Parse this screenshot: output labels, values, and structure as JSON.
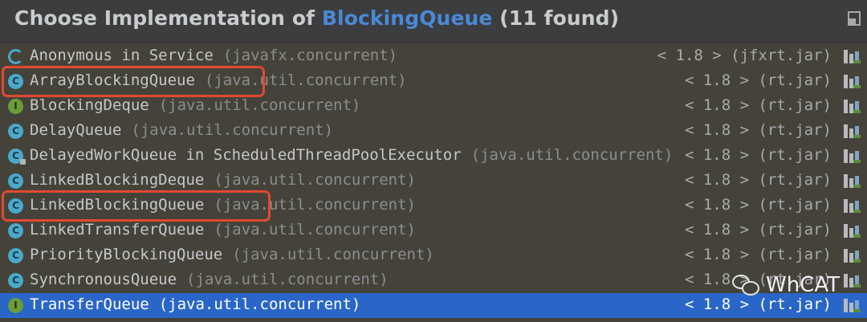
{
  "header": {
    "title_prefix": "Choose Implementation of ",
    "title_class": "BlockingQueue",
    "title_suffix": " (11 found)"
  },
  "items": [
    {
      "kind": "anonymous",
      "name": "Anonymous in Service",
      "package": "(javafx.concurrent)",
      "version": "< 1.8 > (jfxrt.jar)",
      "highlighted": false,
      "selected": false
    },
    {
      "kind": "class",
      "name": "ArrayBlockingQueue",
      "package": "(java.util.concurrent)",
      "version": "< 1.8 > (rt.jar)",
      "highlighted": true,
      "selected": false
    },
    {
      "kind": "interface",
      "name": "BlockingDeque",
      "package": "(java.util.concurrent)",
      "version": "< 1.8 > (rt.jar)",
      "highlighted": false,
      "selected": false
    },
    {
      "kind": "class",
      "name": "DelayQueue",
      "package": "(java.util.concurrent)",
      "version": "< 1.8 > (rt.jar)",
      "highlighted": false,
      "selected": false
    },
    {
      "kind": "class-private",
      "name": "DelayedWorkQueue in ScheduledThreadPoolExecutor",
      "package": "(java.util.concurrent)",
      "version": "< 1.8 > (rt.jar)",
      "highlighted": false,
      "selected": false
    },
    {
      "kind": "class",
      "name": "LinkedBlockingDeque",
      "package": "(java.util.concurrent)",
      "version": "< 1.8 > (rt.jar)",
      "highlighted": false,
      "selected": false
    },
    {
      "kind": "class",
      "name": "LinkedBlockingQueue",
      "package": "(java.util.concurrent)",
      "version": "< 1.8 > (rt.jar)",
      "highlighted": true,
      "selected": false
    },
    {
      "kind": "class",
      "name": "LinkedTransferQueue",
      "package": "(java.util.concurrent)",
      "version": "< 1.8 > (rt.jar)",
      "highlighted": false,
      "selected": false
    },
    {
      "kind": "class",
      "name": "PriorityBlockingQueue",
      "package": "(java.util.concurrent)",
      "version": "< 1.8 > (rt.jar)",
      "highlighted": false,
      "selected": false
    },
    {
      "kind": "class",
      "name": "SynchronousQueue",
      "package": "(java.util.concurrent)",
      "version": "< 1.8 > (rt.jar)",
      "highlighted": false,
      "selected": false
    },
    {
      "kind": "interface",
      "name": "TransferQueue",
      "package": "(java.util.concurrent)",
      "version": "< 1.8 > (rt.jar)",
      "highlighted": false,
      "selected": true
    }
  ],
  "icons": {
    "class_letter": "C",
    "interface_letter": "I",
    "library_icon": "library-jar-icon"
  },
  "watermark": {
    "text": "WhCAT"
  },
  "colors": {
    "header_bg": "#3b3d3f",
    "list_bg": "#45423a",
    "selection": "#2a66c8",
    "title_class": "#4a89d6",
    "highlight_box": "#e04a33"
  }
}
